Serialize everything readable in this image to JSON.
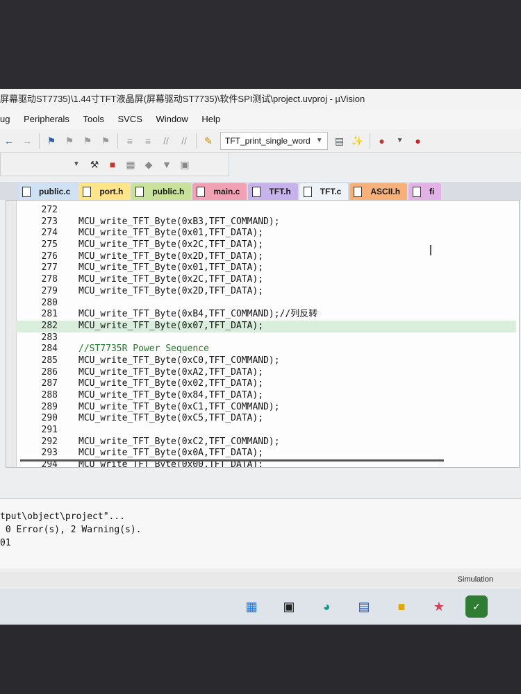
{
  "window": {
    "title": "屏幕驱动ST7735)\\1.44寸TFT液晶屏(屏幕驱动ST7735)\\软件SPI测试\\project.uvproj - µVision"
  },
  "menu": [
    "ug",
    "Peripherals",
    "Tools",
    "SVCS",
    "Window",
    "Help"
  ],
  "toolbar": {
    "target_combo": "TFT_print_single_word"
  },
  "tabs": [
    {
      "label": "public.c",
      "color": "#cfe1f3"
    },
    {
      "label": "port.h",
      "color": "#ffe48a"
    },
    {
      "label": "public.h",
      "color": "#c8e29a"
    },
    {
      "label": "main.c",
      "color": "#f2a1b5"
    },
    {
      "label": "TFT.h",
      "color": "#c7b3ec"
    },
    {
      "label": "TFT.c",
      "color": "#eef3f8",
      "active": true
    },
    {
      "label": "ASCII.h",
      "color": "#f6b07a"
    },
    {
      "label": "fi",
      "color": "#e2b2e6"
    }
  ],
  "code": [
    {
      "n": "272",
      "t": ""
    },
    {
      "n": "273",
      "t": "MCU_write_TFT_Byte(0xB3,TFT_COMMAND);"
    },
    {
      "n": "274",
      "t": "MCU_write_TFT_Byte(0x01,TFT_DATA);"
    },
    {
      "n": "275",
      "t": "MCU_write_TFT_Byte(0x2C,TFT_DATA);"
    },
    {
      "n": "276",
      "t": "MCU_write_TFT_Byte(0x2D,TFT_DATA);"
    },
    {
      "n": "277",
      "t": "MCU_write_TFT_Byte(0x01,TFT_DATA);"
    },
    {
      "n": "278",
      "t": "MCU_write_TFT_Byte(0x2C,TFT_DATA);"
    },
    {
      "n": "279",
      "t": "MCU_write_TFT_Byte(0x2D,TFT_DATA);"
    },
    {
      "n": "280",
      "t": ""
    },
    {
      "n": "281",
      "t": "MCU_write_TFT_Byte(0xB4,TFT_COMMAND);//列反转"
    },
    {
      "n": "282",
      "t": "MCU_write_TFT_Byte(0x07,TFT_DATA);",
      "hl": true
    },
    {
      "n": "283",
      "t": ""
    },
    {
      "n": "284",
      "t": "//ST7735R Power Sequence",
      "comment": true
    },
    {
      "n": "285",
      "t": "MCU_write_TFT_Byte(0xC0,TFT_COMMAND);"
    },
    {
      "n": "286",
      "t": "MCU_write_TFT_Byte(0xA2,TFT_DATA);"
    },
    {
      "n": "287",
      "t": "MCU_write_TFT_Byte(0x02,TFT_DATA);"
    },
    {
      "n": "288",
      "t": "MCU_write_TFT_Byte(0x84,TFT_DATA);"
    },
    {
      "n": "289",
      "t": "MCU_write_TFT_Byte(0xC1,TFT_COMMAND);"
    },
    {
      "n": "290",
      "t": "MCU_write_TFT_Byte(0xC5,TFT_DATA);"
    },
    {
      "n": "291",
      "t": ""
    },
    {
      "n": "292",
      "t": "MCU_write_TFT_Byte(0xC2,TFT_COMMAND);"
    },
    {
      "n": "293",
      "t": "MCU_write_TFT_Byte(0x0A,TFT_DATA);"
    },
    {
      "n": "294",
      "t": "MCU_write_TFT_Byte(0x00,TFT_DATA);"
    }
  ],
  "build_output": [
    "tput\\object\\project\"...",
    " 0 Error(s), 2 Warning(s).",
    "01"
  ],
  "status": "Simulation"
}
